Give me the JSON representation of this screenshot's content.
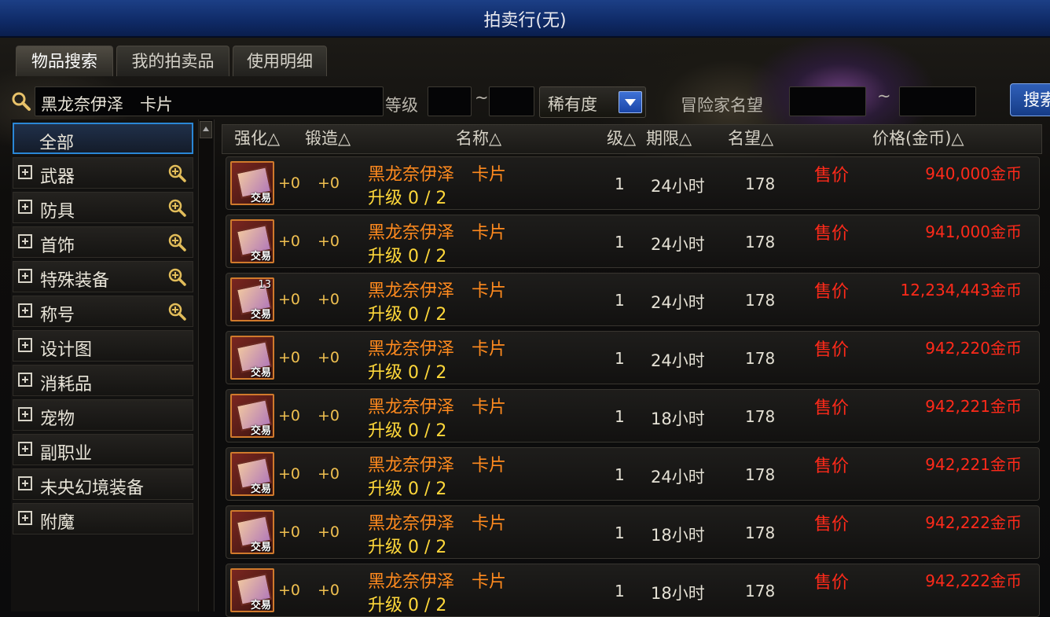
{
  "window": {
    "title": "拍卖行(无)"
  },
  "tabs": [
    {
      "label": "物品搜索",
      "active": true
    },
    {
      "label": "我的拍卖品",
      "active": false
    },
    {
      "label": "使用明细",
      "active": false
    }
  ],
  "search": {
    "query": "黑龙奈伊泽　卡片",
    "level_label": "等级",
    "tilde": "~",
    "level_min": "",
    "level_max": "",
    "rarity_label": "稀有度",
    "adventurer_fame_label": "冒险家名望",
    "fame_min": "",
    "fame_max": "",
    "search_button": "搜索"
  },
  "categories": [
    {
      "label": "全部",
      "selected": true,
      "expandable": false,
      "zoom": false
    },
    {
      "label": "武器",
      "selected": false,
      "expandable": true,
      "zoom": true
    },
    {
      "label": "防具",
      "selected": false,
      "expandable": true,
      "zoom": true
    },
    {
      "label": "首饰",
      "selected": false,
      "expandable": true,
      "zoom": true
    },
    {
      "label": "特殊装备",
      "selected": false,
      "expandable": true,
      "zoom": true
    },
    {
      "label": "称号",
      "selected": false,
      "expandable": true,
      "zoom": true
    },
    {
      "label": "设计图",
      "selected": false,
      "expandable": true,
      "zoom": false
    },
    {
      "label": "消耗品",
      "selected": false,
      "expandable": true,
      "zoom": false
    },
    {
      "label": "宠物",
      "selected": false,
      "expandable": true,
      "zoom": false
    },
    {
      "label": "副职业",
      "selected": false,
      "expandable": true,
      "zoom": false
    },
    {
      "label": "未央幻境装备",
      "selected": false,
      "expandable": true,
      "zoom": false
    },
    {
      "label": "附魔",
      "selected": false,
      "expandable": true,
      "zoom": false
    }
  ],
  "columns": {
    "enhance": "强化△",
    "forge": "锻造△",
    "name": "名称△",
    "level": "级△",
    "duration": "期限△",
    "fame": "名望△",
    "price": "价格(金币)△"
  },
  "listings": [
    {
      "enhance": "+0",
      "forge": "+0",
      "name": "黑龙奈伊泽　卡片",
      "upgrade": "升级 0 / 2",
      "level": "1",
      "duration": "24小时",
      "fame": "178",
      "price_label": "售价",
      "price": "940,000金币",
      "count": "",
      "trade": "交易"
    },
    {
      "enhance": "+0",
      "forge": "+0",
      "name": "黑龙奈伊泽　卡片",
      "upgrade": "升级 0 / 2",
      "level": "1",
      "duration": "24小时",
      "fame": "178",
      "price_label": "售价",
      "price": "941,000金币",
      "count": "",
      "trade": "交易"
    },
    {
      "enhance": "+0",
      "forge": "+0",
      "name": "黑龙奈伊泽　卡片",
      "upgrade": "升级 0 / 2",
      "level": "1",
      "duration": "24小时",
      "fame": "178",
      "price_label": "售价",
      "price": "12,234,443金币",
      "count": "13",
      "trade": "交易"
    },
    {
      "enhance": "+0",
      "forge": "+0",
      "name": "黑龙奈伊泽　卡片",
      "upgrade": "升级 0 / 2",
      "level": "1",
      "duration": "24小时",
      "fame": "178",
      "price_label": "售价",
      "price": "942,220金币",
      "count": "",
      "trade": "交易"
    },
    {
      "enhance": "+0",
      "forge": "+0",
      "name": "黑龙奈伊泽　卡片",
      "upgrade": "升级 0 / 2",
      "level": "1",
      "duration": "18小时",
      "fame": "178",
      "price_label": "售价",
      "price": "942,221金币",
      "count": "",
      "trade": "交易"
    },
    {
      "enhance": "+0",
      "forge": "+0",
      "name": "黑龙奈伊泽　卡片",
      "upgrade": "升级 0 / 2",
      "level": "1",
      "duration": "24小时",
      "fame": "178",
      "price_label": "售价",
      "price": "942,221金币",
      "count": "",
      "trade": "交易"
    },
    {
      "enhance": "+0",
      "forge": "+0",
      "name": "黑龙奈伊泽　卡片",
      "upgrade": "升级 0 / 2",
      "level": "1",
      "duration": "18小时",
      "fame": "178",
      "price_label": "售价",
      "price": "942,222金币",
      "count": "",
      "trade": "交易"
    },
    {
      "enhance": "+0",
      "forge": "+0",
      "name": "黑龙奈伊泽　卡片",
      "upgrade": "升级 0 / 2",
      "level": "1",
      "duration": "18小时",
      "fame": "178",
      "price_label": "售价",
      "price": "942,222金币",
      "count": "",
      "trade": "交易"
    }
  ],
  "colors": {
    "title_bar": "#0f2a66",
    "price": "#ff2a1a",
    "item_name": "#ff8a1e",
    "upgrade": "#ffd83a",
    "selection": "#2a87d6"
  }
}
